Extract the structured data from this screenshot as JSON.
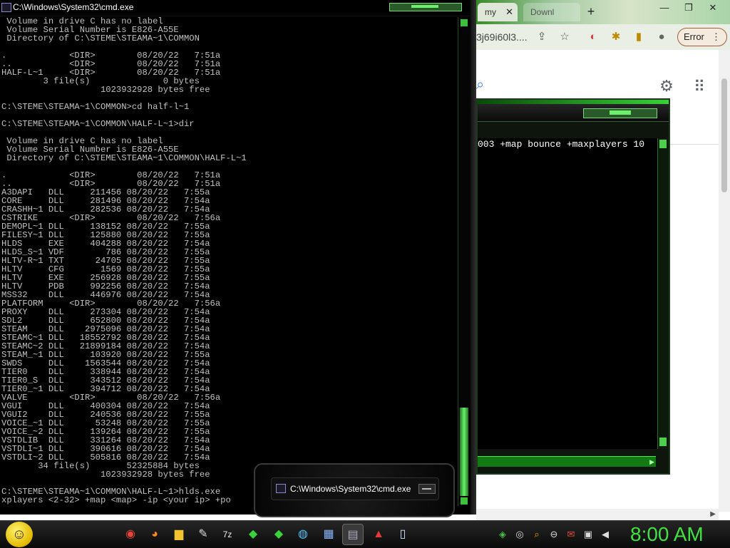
{
  "browser": {
    "tabs": [
      {
        "label": "my",
        "close": "✕"
      },
      {
        "label": "Downl"
      }
    ],
    "new_tab": "+",
    "window_controls": [
      "—",
      "❐",
      "✕"
    ],
    "url_fragment": "3j69i60l3....",
    "error_button": "Error",
    "error_menu": "⋮"
  },
  "hlds": {
    "command_line": "003 +map bounce +maxplayers 10"
  },
  "cmd": {
    "title": "C:\\Windows\\System32\\cmd.exe",
    "console_text": " Volume in drive C has no label\n Volume Serial Number is E826-A55E\n Directory of C:\\STEME\\STEAMA~1\\COMMON\n\n.            <DIR>        08/20/22   7:51a\n..           <DIR>        08/20/22   7:51a\nHALF-L~1     <DIR>        08/20/22   7:51a\n        3 file(s)              0 bytes\n                   1023932928 bytes free\n\nC:\\STEME\\STEAMA~1\\COMMON>cd half-l~1\n\nC:\\STEME\\STEAMA~1\\COMMON\\HALF-L~1>dir\n\n Volume in drive C has no label\n Volume Serial Number is E826-A55E\n Directory of C:\\STEME\\STEAMA~1\\COMMON\\HALF-L~1\n\n.            <DIR>        08/20/22   7:51a\n..           <DIR>        08/20/22   7:51a\nA3DAPI   DLL     211456 08/20/22   7:55a\nCORE     DLL     281496 08/20/22   7:54a\nCRASHH~1 DLL     282536 08/20/22   7:54a\nCSTRIKE      <DIR>        08/20/22   7:56a\nDEMOPL~1 DLL     138152 08/20/22   7:55a\nFILESY~1 DLL     125880 08/20/22   7:55a\nHLDS     EXE     404288 08/20/22   7:54a\nHLDS_S~1 VDF        786 08/20/22   7:55a\nHLTV-R~1 TXT      24705 08/20/22   7:55a\nHLTV     CFG       1569 08/20/22   7:55a\nHLTV     EXE     256928 08/20/22   7:55a\nHLTV     PDB     992256 08/20/22   7:54a\nMSS32    DLL     446976 08/20/22   7:54a\nPLATFORM     <DIR>        08/20/22   7:56a\nPROXY    DLL     273304 08/20/22   7:54a\nSDL2     DLL     652800 08/20/22   7:54a\nSTEAM    DLL    2975096 08/20/22   7:54a\nSTEAMC~1 DLL   18552792 08/20/22   7:54a\nSTEAMC~2 DLL   21899184 08/20/22   7:54a\nSTEAM_~1 DLL     103920 08/20/22   7:55a\nSWDS     DLL    1563544 08/20/22   7:54a\nTIER0    DLL     338944 08/20/22   7:54a\nTIER0_S  DLL     343512 08/20/22   7:54a\nTIER0_~1 DLL     394712 08/20/22   7:54a\nVALVE        <DIR>        08/20/22   7:56a\nVGUI     DLL     400304 08/20/22   7:54a\nVGUI2    DLL     240536 08/20/22   7:55a\nVOICE_~1 DLL      53248 08/20/22   7:55a\nVOICE_~2 DLL     139264 08/20/22   7:55a\nVSTDLIB  DLL     331264 08/20/22   7:54a\nVSTDLI~1 DLL     390616 08/20/22   7:54a\nVSTDLI~2 DLL     505816 08/20/22   7:54a\n       34 file(s)       52325884 bytes\n                   1023932928 bytes free\n\nC:\\STEME\\STEAMA~1\\COMMON\\HALF-L~1>hlds.exe\nxplayers <2-32> +map <map> -ip <your ip> +po"
  },
  "thumbnail": {
    "label": "C:\\Windows\\System32\\cmd.exe"
  },
  "taskbar": {
    "clock": "8:00 AM",
    "pinned_icons": [
      "chrome-icon",
      "firefox-icon",
      "explorer-icon",
      "notepad-icon",
      "7zip-icon",
      "app-f-icon",
      "app-g-icon",
      "paint-icon",
      "app-blocks-icon",
      "cmd-icon",
      "adobe-icon",
      "files-icon"
    ],
    "tray_icons": [
      "network-icon",
      "steam-icon",
      "search-icon",
      "display-icon",
      "mail-icon",
      "device-icon",
      "volume-icon"
    ]
  }
}
